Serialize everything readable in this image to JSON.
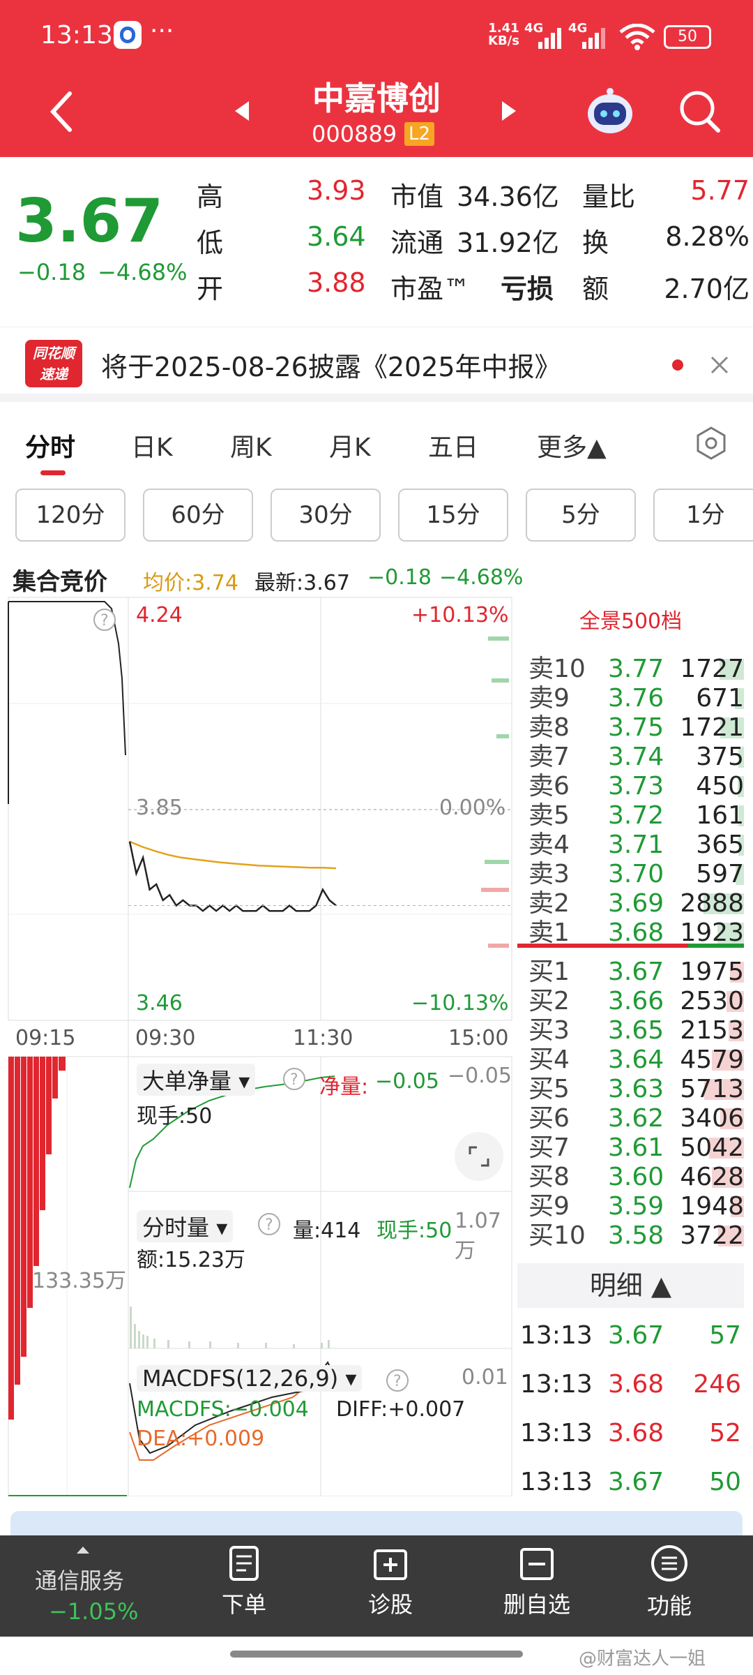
{
  "status": {
    "time": "13:13",
    "net_speed": "1.41\nKB/s",
    "net_speed_top": "1.41",
    "net_speed_bottom": "KB/s",
    "signal1": "4G",
    "signal2": "4G",
    "battery": "50"
  },
  "header": {
    "title": "中嘉博创",
    "code": "000889",
    "badge": "L2"
  },
  "quote": {
    "price": "3.67",
    "change": "−0.18",
    "change_pct": "−4.68%",
    "high_label": "高",
    "high": "3.93",
    "low_label": "低",
    "low": "3.64",
    "open_label": "开",
    "open": "3.88",
    "mktcap_label": "市值",
    "mktcap": "34.36亿",
    "float_label": "流通",
    "float": "31.92亿",
    "pe_label": "市盈™",
    "pe": "亏损",
    "volratio_label": "量比",
    "volratio": "5.77",
    "turnover_label": "换",
    "turnover": "8.28%",
    "amount_label": "额",
    "amount": "2.70亿"
  },
  "notice": {
    "logo_top": "同花顺",
    "logo_bottom": "速递",
    "text": "将于2025-08-26披露《2025年中报》"
  },
  "tabs": [
    {
      "label": "分时"
    },
    {
      "label": "日K"
    },
    {
      "label": "周K"
    },
    {
      "label": "月K"
    },
    {
      "label": "五日"
    },
    {
      "label": "更多▲"
    }
  ],
  "periods": [
    "120分",
    "60分",
    "30分",
    "15分",
    "5分",
    "1分"
  ],
  "infoline": {
    "auction": "集合竞价",
    "avg": "均价:3.74",
    "latest": "最新:3.67",
    "chg": "−0.18",
    "pct": "−4.68%"
  },
  "chart": {
    "price_high": "4.24",
    "price_mid": "3.85",
    "price_low": "3.46",
    "pct_high": "+10.13%",
    "pct_mid": "0.00%",
    "pct_low": "−10.13%",
    "time_labels": [
      "09:15",
      "09:30",
      "11:30",
      "15:00"
    ],
    "bigorder_label": "大单净量",
    "net_label": "净量:",
    "net_value": "−0.05",
    "net_right": "−0.05",
    "hand_label": "现手:50",
    "vol_label": "分时量",
    "vol_value": "量:414",
    "vol_hand": "现手:50",
    "vol_right": "1.07万",
    "amount_line": "额:15.23万",
    "auction_vol": "133.35万",
    "macd_label": "MACDFS(12,26,9)",
    "macd_right": "0.01",
    "macd_value": "MACDFS:−0.004",
    "diff": "DIFF:+0.007",
    "dea": "DEA:+0.009",
    "avg_series": [
      3.79,
      3.78,
      3.772,
      3.765,
      3.76,
      3.757,
      3.754,
      3.751,
      3.749,
      3.747,
      3.745,
      3.744,
      3.743,
      3.742,
      3.741,
      3.741,
      3.74
    ],
    "price_series": [
      3.79,
      3.73,
      3.76,
      3.7,
      3.71,
      3.68,
      3.69,
      3.67,
      3.68,
      3.67,
      3.67,
      3.66,
      3.67,
      3.66,
      3.67,
      3.66,
      3.67,
      3.66,
      3.66,
      3.66,
      3.67,
      3.66,
      3.66,
      3.66,
      3.67,
      3.66,
      3.66,
      3.66,
      3.67,
      3.7,
      3.68,
      3.67
    ]
  },
  "orderbook": {
    "title": "全景500档",
    "asks": [
      {
        "label": "卖10",
        "price": "3.77",
        "vol": "1727"
      },
      {
        "label": "卖9",
        "price": "3.76",
        "vol": "671"
      },
      {
        "label": "卖8",
        "price": "3.75",
        "vol": "1721"
      },
      {
        "label": "卖7",
        "price": "3.74",
        "vol": "375"
      },
      {
        "label": "卖6",
        "price": "3.73",
        "vol": "450"
      },
      {
        "label": "卖5",
        "price": "3.72",
        "vol": "161"
      },
      {
        "label": "卖4",
        "price": "3.71",
        "vol": "365"
      },
      {
        "label": "卖3",
        "price": "3.70",
        "vol": "597"
      },
      {
        "label": "卖2",
        "price": "3.69",
        "vol": "2888"
      },
      {
        "label": "卖1",
        "price": "3.68",
        "vol": "1923"
      }
    ],
    "bids": [
      {
        "label": "买1",
        "price": "3.67",
        "vol": "1975"
      },
      {
        "label": "买2",
        "price": "3.66",
        "vol": "2530"
      },
      {
        "label": "买3",
        "price": "3.65",
        "vol": "2153"
      },
      {
        "label": "买4",
        "price": "3.64",
        "vol": "4579"
      },
      {
        "label": "买5",
        "price": "3.63",
        "vol": "5713"
      },
      {
        "label": "买6",
        "price": "3.62",
        "vol": "3406"
      },
      {
        "label": "买7",
        "price": "3.61",
        "vol": "5042"
      },
      {
        "label": "买8",
        "price": "3.60",
        "vol": "4628"
      },
      {
        "label": "买9",
        "price": "3.59",
        "vol": "1948"
      },
      {
        "label": "买10",
        "price": "3.58",
        "vol": "3722"
      }
    ],
    "detail_title": "明细 ▲",
    "details": [
      {
        "time": "13:13",
        "price": "3.67",
        "vol": "57",
        "dir": "green"
      },
      {
        "time": "13:13",
        "price": "3.68",
        "vol": "246",
        "dir": "red"
      },
      {
        "time": "13:13",
        "price": "3.68",
        "vol": "52",
        "dir": "red"
      },
      {
        "time": "13:13",
        "price": "3.67",
        "vol": "50",
        "dir": "green"
      }
    ]
  },
  "bottom": {
    "market_label": "通信服务",
    "market_change": "−1.05%",
    "items": [
      {
        "label": "下单"
      },
      {
        "label": "诊股"
      },
      {
        "label": "删自选"
      },
      {
        "label": "功能"
      }
    ]
  },
  "watermark": "@财富达人一姐",
  "colors": {
    "header": "#eb3340",
    "up": "#e0262f",
    "down": "#1f9a35",
    "avg_line": "#e3a21a"
  }
}
